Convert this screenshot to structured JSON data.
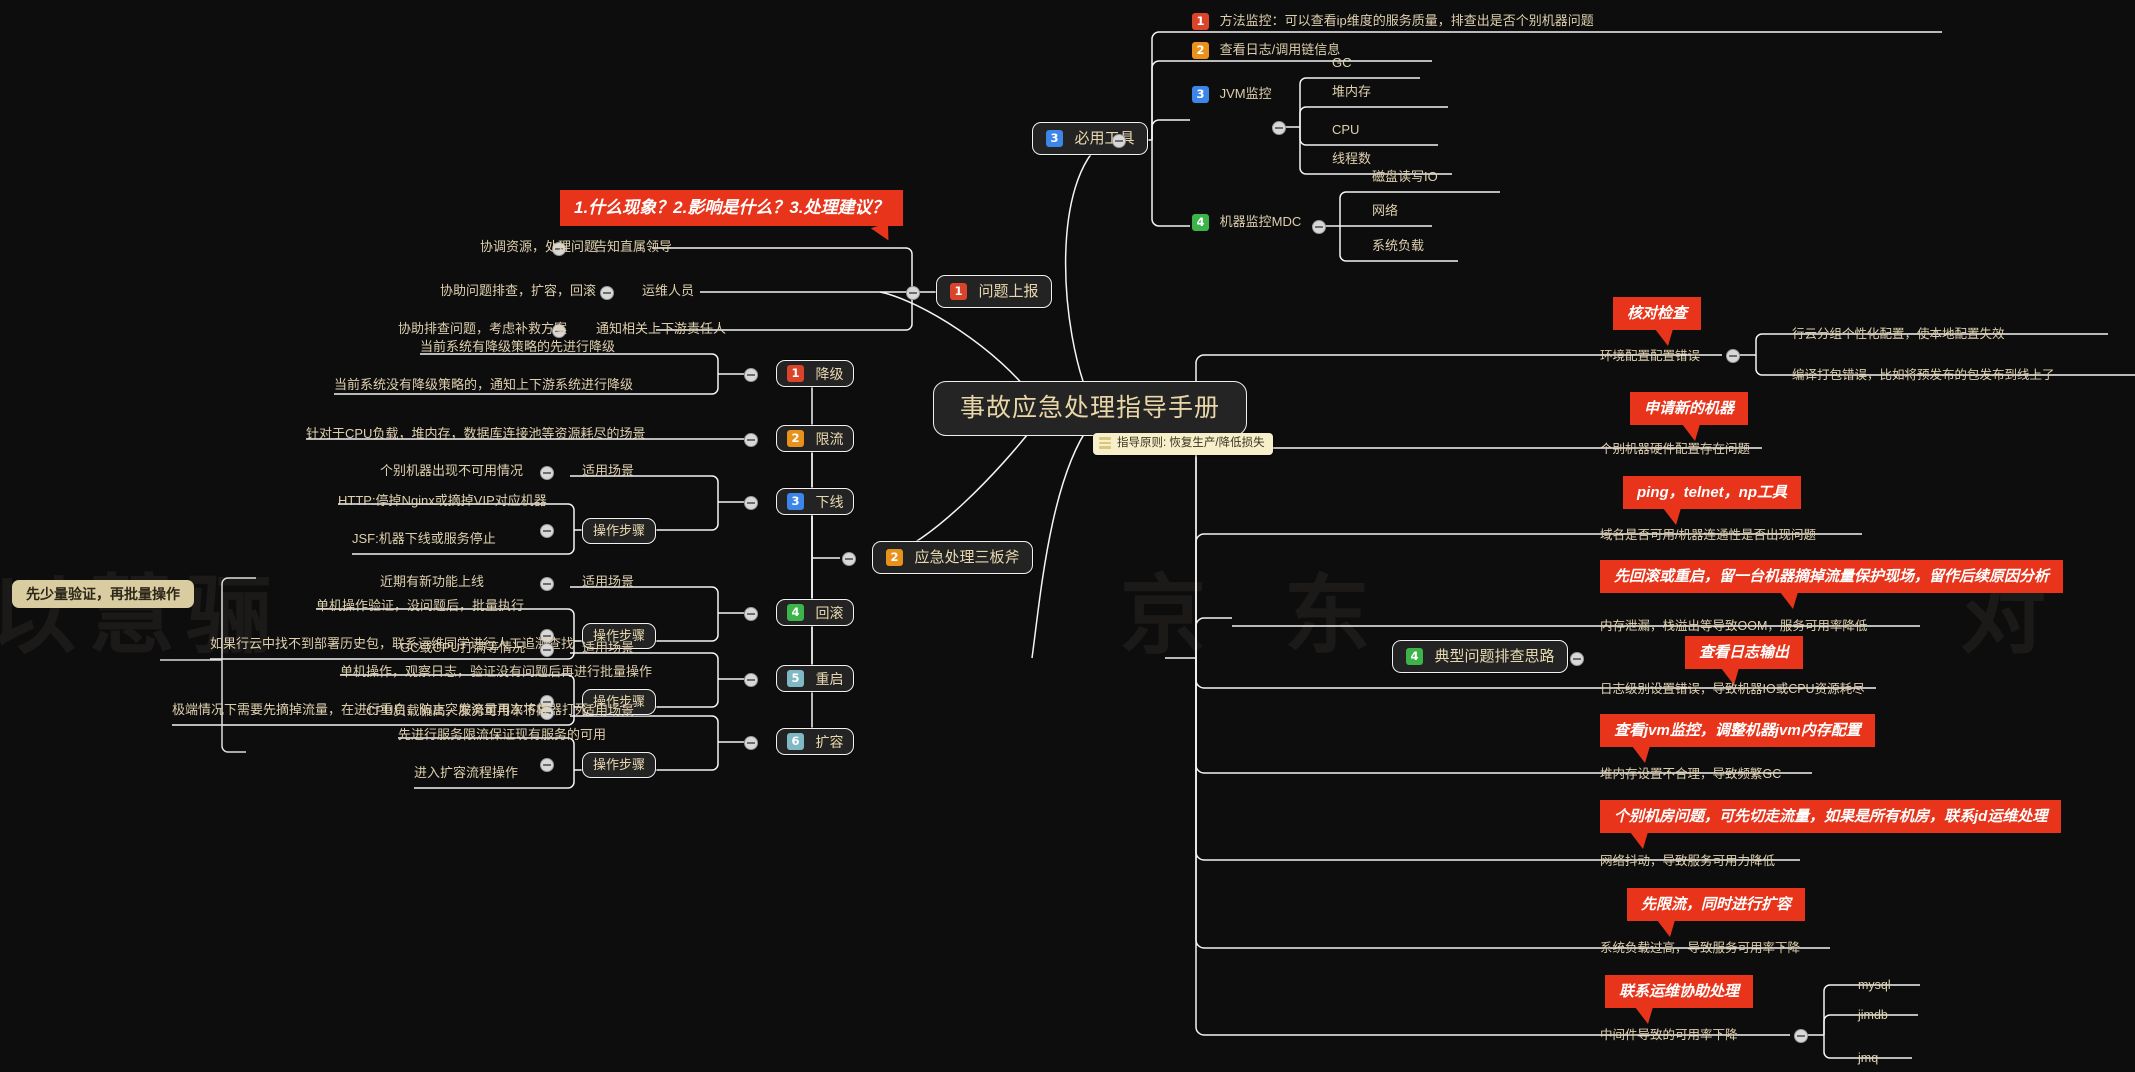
{
  "root": {
    "title": "事故应急处理指导手册",
    "note": "指导原则: 恢复生产/降低损失"
  },
  "sticky_left": "先少量验证，再批量操作",
  "branches": {
    "report": {
      "num": "1",
      "label": "问题上报",
      "callout": "1.什么现象？2.影响是什么？3.处理建议？",
      "children": [
        {
          "label": "告知直属领导",
          "detail": "协调资源，处理问题"
        },
        {
          "label": "运维人员",
          "detail": "协助问题排查，扩容，回滚"
        },
        {
          "label": "通知相关上下游责任人",
          "detail": "协助排查问题，考虑补救方案"
        }
      ]
    },
    "three_axes": {
      "num": "2",
      "label": "应急处理三板斧",
      "items": [
        {
          "num": "1",
          "color": "c1",
          "label": "降级",
          "groups": [
            {
              "title": "",
              "lines": [
                "当前系统有降级策略的先进行降级",
                "当前系统没有降级策略的，通知上下游系统进行降级"
              ]
            }
          ]
        },
        {
          "num": "2",
          "color": "c2",
          "label": "限流",
          "groups": [
            {
              "title": "",
              "lines": [
                "针对于CPU负载，堆内存，数据库连接池等资源耗尽的场景"
              ]
            }
          ]
        },
        {
          "num": "3",
          "color": "c3",
          "label": "下线",
          "groups": [
            {
              "title": "适用场景",
              "lines": [
                "个别机器出现不可用情况"
              ]
            },
            {
              "title": "操作步骤",
              "lines": [
                "HTTP:停掉Nginx或摘掉VIP对应机器",
                "JSF:机器下线或服务停止"
              ]
            }
          ]
        },
        {
          "num": "4",
          "color": "c4",
          "label": "回滚",
          "groups": [
            {
              "title": "适用场景",
              "lines": [
                "近期有新功能上线"
              ]
            },
            {
              "title": "操作步骤",
              "lines": [
                "单机操作验证，没问题后，批量执行",
                "如果行云中找不到部署历史包，联系运维同学进行人工追溯查找"
              ]
            }
          ]
        },
        {
          "num": "5",
          "color": "c5",
          "label": "重启",
          "groups": [
            {
              "title": "适用场景",
              "lines": [
                "GC或CPU打满等情况"
              ]
            },
            {
              "title": "操作步骤",
              "lines": [
                "单机操作，观察日志，验证没有问题后再进行批量操作",
                "极端情况下需要先摘掉流量，在进行重启，防止突发流量再次将机器打死"
              ]
            }
          ]
        },
        {
          "num": "6",
          "color": "c6",
          "label": "扩容",
          "groups": [
            {
              "title": "适用场景",
              "lines": [
                "CPU负载偏高，服务可用率下降"
              ]
            },
            {
              "title": "操作步骤",
              "lines": [
                "先进行服务限流保证现有服务的可用",
                "进入扩容流程操作"
              ]
            }
          ]
        }
      ]
    },
    "tools": {
      "num": "3",
      "label": "必用工具",
      "items": [
        {
          "num": "1",
          "color": "c1",
          "label": "方法监控：可以查看ip维度的服务质量，排查出是否个别机器问题",
          "children": []
        },
        {
          "num": "2",
          "color": "c2",
          "label": "查看日志/调用链信息",
          "children": []
        },
        {
          "num": "3",
          "color": "c3",
          "label": "JVM监控",
          "children": [
            "GC",
            "堆内存",
            "CPU",
            "线程数"
          ]
        },
        {
          "num": "4",
          "color": "c4",
          "label": "机器监控MDC",
          "children": [
            "磁盘读写IO",
            "网络",
            "系统负载"
          ]
        }
      ]
    },
    "troubleshoot": {
      "num": "4",
      "label": "典型问题排查思路",
      "items": [
        {
          "callout": "核对检查",
          "label": "环境配置配置错误",
          "children": [
            "行云分组个性化配置，使本地配置失效",
            "编译打包错误，比如将预发布的包发布到线上了"
          ]
        },
        {
          "callout": "申请新的机器",
          "label": "个别机器硬件配置存在问题",
          "children": []
        },
        {
          "callout": "ping，telnet，np工具",
          "label": "域名是否可用/机器连通性是否出现问题",
          "children": []
        },
        {
          "callout": "先回滚或重启，留一台机器摘掉流量保护现场，留作后续原因分析",
          "label": "内存泄漏，栈溢出等导致OOM，服务可用率降低",
          "children": []
        },
        {
          "callout": "查看日志输出",
          "label": "日志级别设置错误，导致机器IO或CPU资源耗尽",
          "children": []
        },
        {
          "callout": "查看jvm监控，调整机器jvm内存配置",
          "label": "堆内存设置不合理，导致频繁GC",
          "children": []
        },
        {
          "callout": "个别机房问题，可先切走流量，如果是所有机房，联系jd运维处理",
          "label": "网络抖动，导致服务可用力降低",
          "children": []
        },
        {
          "callout": "先限流，同时进行扩容",
          "label": "系统负载过高，导致服务可用率下降",
          "children": []
        },
        {
          "callout": "联系运维协助处理",
          "label": "中间件导致的可用率下降",
          "children": [
            "mysql",
            "jimdb",
            "jmq"
          ]
        }
      ]
    }
  },
  "watermark": [
    "以 慧 骊",
    "京 东",
    "对"
  ]
}
